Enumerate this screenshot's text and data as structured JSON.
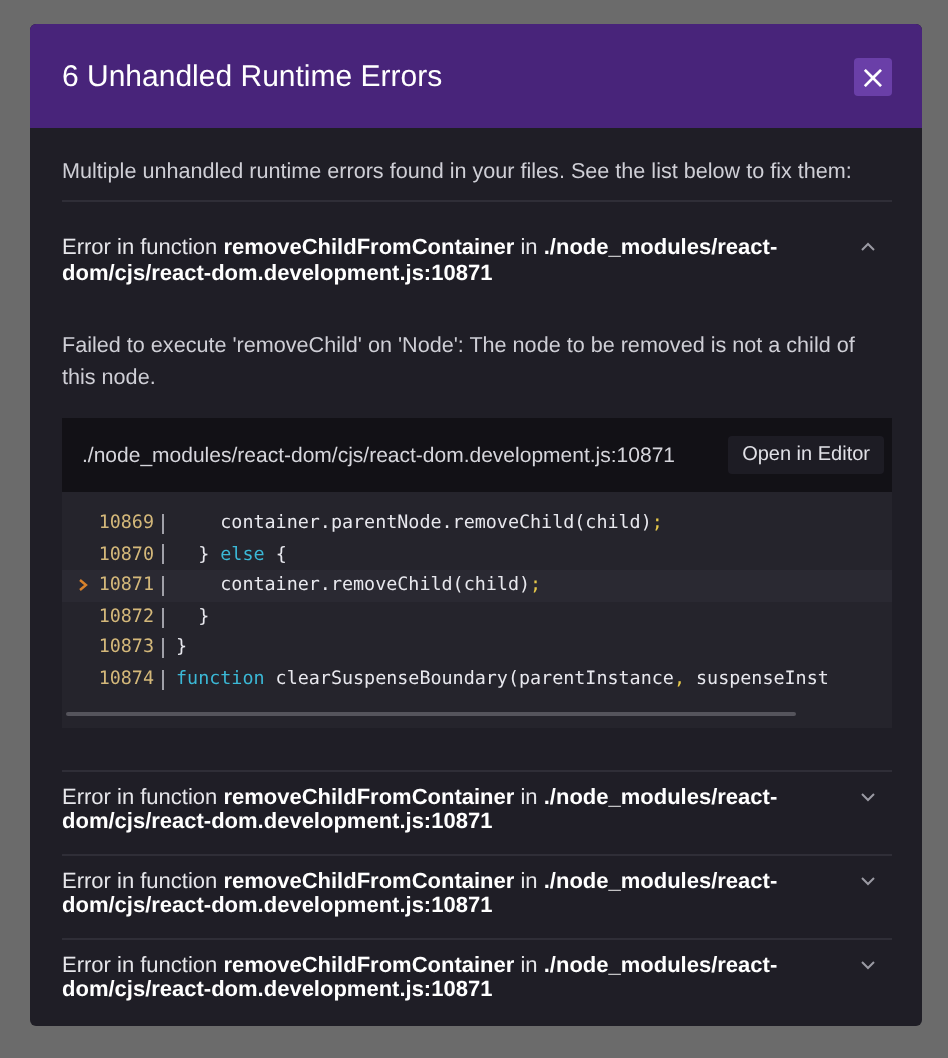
{
  "dialog": {
    "title": "6 Unhandled Runtime Errors",
    "close": "×"
  },
  "intro": "Multiple unhandled runtime errors found in your files. See the list below to fix them:",
  "errors": [
    {
      "heading": "Error in function **removeChildFromContainer** in **./node_modules/react-dom/cjs/react-dom.development.js:10871**",
      "expanded": true,
      "message": "Failed to execute 'removeChild' on 'Node': The node to be removed is not a child of this node.",
      "file": "./node_modules/react-dom/cjs/react-dom.development.js:10871",
      "open_button": "Open in Editor",
      "code": [
        {
          "number": "10869",
          "highlighted": false,
          "segments": [
            {
              "kind": "plain",
              "text": "    container.parentNode.removeChild(child)"
            },
            {
              "kind": "punct",
              "text": ";"
            }
          ]
        },
        {
          "number": "10870",
          "highlighted": false,
          "segments": [
            {
              "kind": "plain",
              "text": "  } "
            },
            {
              "kind": "keyword",
              "text": "else"
            },
            {
              "kind": "plain",
              "text": " {"
            }
          ]
        },
        {
          "number": "10871",
          "highlighted": true,
          "segments": [
            {
              "kind": "plain",
              "text": "    container.removeChild(child)"
            },
            {
              "kind": "punct",
              "text": ";"
            }
          ]
        },
        {
          "number": "10872",
          "highlighted": false,
          "segments": [
            {
              "kind": "plain",
              "text": "  }"
            }
          ]
        },
        {
          "number": "10873",
          "highlighted": false,
          "segments": [
            {
              "kind": "plain",
              "text": "}"
            }
          ]
        },
        {
          "number": "10874",
          "highlighted": false,
          "segments": [
            {
              "kind": "keyword",
              "text": "function"
            },
            {
              "kind": "plain",
              "text": " clearSuspenseBoundary(parentInstance"
            },
            {
              "kind": "punct",
              "text": ","
            },
            {
              "kind": "plain",
              "text": " suspenseInst"
            }
          ]
        }
      ]
    },
    {
      "heading": "Error in function **removeChildFromContainer** in **./node_modules/react-dom/cjs/react-dom.development.js:10871**",
      "expanded": false
    },
    {
      "heading": "Error in function **removeChildFromContainer** in **./node_modules/react-dom/cjs/react-dom.development.js:10871**",
      "expanded": false
    },
    {
      "heading": "Error in function **removeChildFromContainer** in **./node_modules/react-dom/cjs/react-dom.development.js:10871**",
      "expanded": false
    }
  ]
}
